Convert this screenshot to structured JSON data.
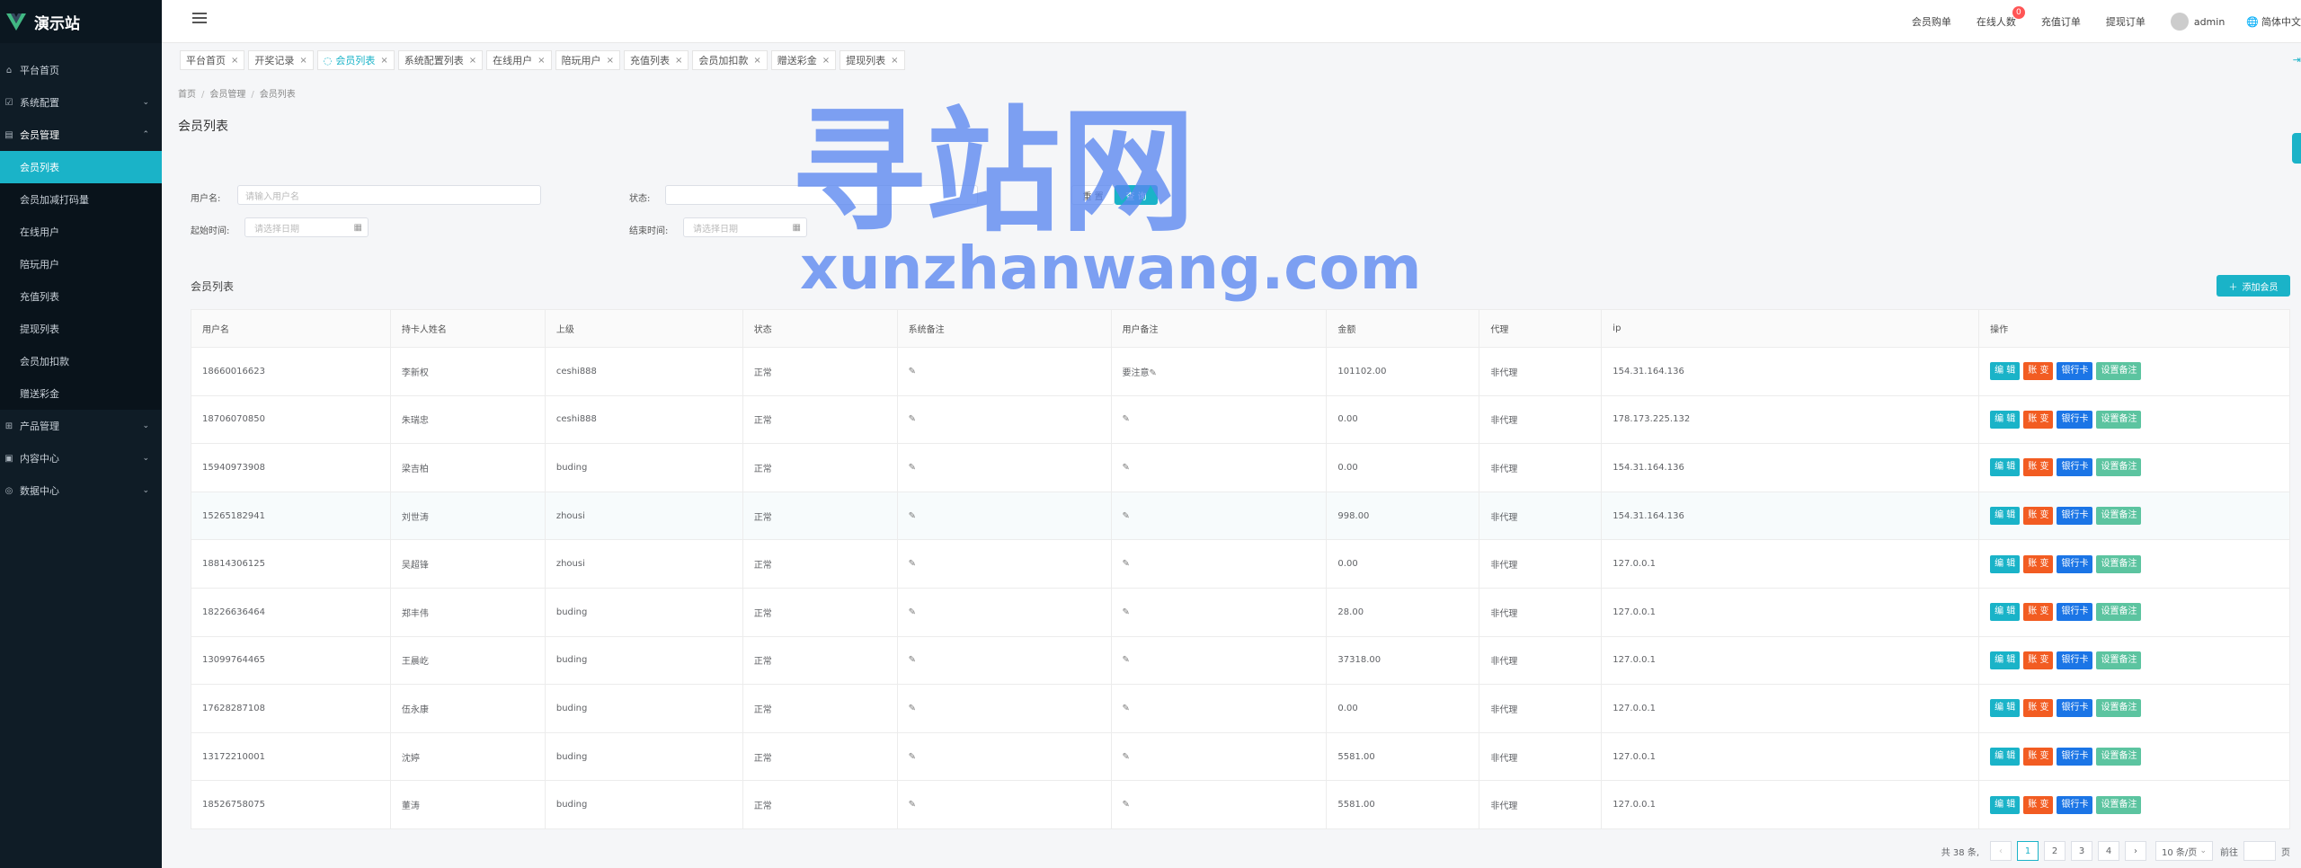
{
  "app": {
    "title": "演示站"
  },
  "sidebar": {
    "items": [
      {
        "label": "平台首页",
        "icon": "home-icon"
      },
      {
        "label": "系统配置",
        "icon": "settings-icon",
        "chevron": "down"
      },
      {
        "label": "会员管理",
        "icon": "users-icon",
        "chevron": "up"
      },
      {
        "label": "产品管理",
        "icon": "grid-icon",
        "chevron": "down"
      },
      {
        "label": "内容中心",
        "icon": "content-icon",
        "chevron": "down"
      },
      {
        "label": "数据中心",
        "icon": "data-icon",
        "chevron": "down"
      }
    ],
    "submenu": [
      {
        "label": "会员列表",
        "active": true
      },
      {
        "label": "会员加减打码量"
      },
      {
        "label": "在线用户"
      },
      {
        "label": "陪玩用户"
      },
      {
        "label": "充值列表"
      },
      {
        "label": "提现列表"
      },
      {
        "label": "会员加扣款"
      },
      {
        "label": "赠送彩金"
      }
    ]
  },
  "header": {
    "links": [
      "会员购单",
      "在线人数",
      "充值订单",
      "提现订单"
    ],
    "online_badge": "0",
    "user": "admin",
    "lang": "简体中文"
  },
  "tabs": [
    {
      "label": "平台首页"
    },
    {
      "label": "开奖记录"
    },
    {
      "label": "会员列表",
      "active": true
    },
    {
      "label": "系统配置列表"
    },
    {
      "label": "在线用户"
    },
    {
      "label": "陪玩用户"
    },
    {
      "label": "充值列表"
    },
    {
      "label": "会员加扣款"
    },
    {
      "label": "赠送彩金"
    },
    {
      "label": "提现列表"
    }
  ],
  "breadcrumb": [
    "首页",
    "会员管理",
    "会员列表"
  ],
  "page_title": "会员列表",
  "filters": {
    "username_label": "用户名:",
    "username_placeholder": "请输入用户名",
    "status_label": "状态:",
    "start_label": "起始时间:",
    "start_placeholder": "请选择日期",
    "end_label": "结束时间:",
    "end_placeholder": "请选择日期",
    "reset_label": "重 置",
    "search_label": "查 询"
  },
  "section_title": "会员列表",
  "add_button": "添加会员",
  "table": {
    "headers": [
      "用户名",
      "持卡人姓名",
      "上级",
      "状态",
      "系统备注",
      "用户备注",
      "金额",
      "代理",
      "ip",
      "操作"
    ],
    "rows": [
      [
        "18660016623",
        "李新权",
        "ceshi888",
        "正常",
        "",
        "要注意",
        "101102.00",
        "非代理",
        "154.31.164.136"
      ],
      [
        "18706070850",
        "朱瑞忠",
        "ceshi888",
        "正常",
        "",
        "",
        "0.00",
        "非代理",
        "178.173.225.132"
      ],
      [
        "15940973908",
        "梁吉柏",
        "buding",
        "正常",
        "",
        "",
        "0.00",
        "非代理",
        "154.31.164.136"
      ],
      [
        "15265182941",
        "刘世涛",
        "zhousi",
        "正常",
        "",
        "",
        "998.00",
        "非代理",
        "154.31.164.136"
      ],
      [
        "18814306125",
        "吴超锋",
        "zhousi",
        "正常",
        "",
        "",
        "0.00",
        "非代理",
        "127.0.0.1"
      ],
      [
        "18226636464",
        "郑丰伟",
        "buding",
        "正常",
        "",
        "",
        "28.00",
        "非代理",
        "127.0.0.1"
      ],
      [
        "13099764465",
        "王晨屹",
        "buding",
        "正常",
        "",
        "",
        "37318.00",
        "非代理",
        "127.0.0.1"
      ],
      [
        "17628287108",
        "伍永康",
        "buding",
        "正常",
        "",
        "",
        "0.00",
        "非代理",
        "127.0.0.1"
      ],
      [
        "13172210001",
        "沈婷",
        "buding",
        "正常",
        "",
        "",
        "5581.00",
        "非代理",
        "127.0.0.1"
      ],
      [
        "18526758075",
        "董涛",
        "buding",
        "正常",
        "",
        "",
        "5581.00",
        "非代理",
        "127.0.0.1"
      ]
    ],
    "actions": [
      "编 辑",
      "账 变",
      "银行卡",
      "设置备注"
    ]
  },
  "pagination": {
    "total": "共 38 条,",
    "pages": [
      "1",
      "2",
      "3",
      "4"
    ],
    "current": "1",
    "page_size": "10 条/页",
    "goto_label": "前往",
    "page_suffix": "页"
  },
  "watermark": {
    "big": "寻站网",
    "small": "xunzhanwang.com"
  },
  "colors": {
    "accent": "#1ab3c8",
    "sidebar_bg": "#0f1c26",
    "bill": "#f25c22",
    "bank": "#1b75e6",
    "note": "#5cc4a0"
  }
}
